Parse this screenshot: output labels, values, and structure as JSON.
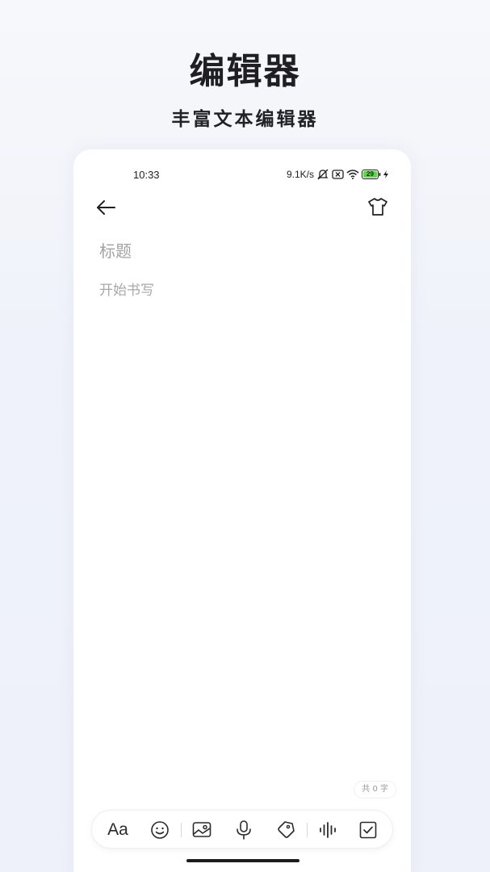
{
  "promo": {
    "title": "编辑器",
    "subtitle": "丰富文本编辑器"
  },
  "status_bar": {
    "time": "10:33",
    "net_speed": "9.1K/s",
    "battery": "29",
    "icons": [
      "mute-icon",
      "sim-x-icon",
      "wifi-icon",
      "battery-icon",
      "charging-icon"
    ]
  },
  "editor": {
    "title_placeholder": "标题",
    "body_placeholder": "开始书写",
    "word_count": "共 0 字"
  },
  "toolbar": {
    "font_label": "Aa",
    "tools": [
      "font-icon",
      "emoji-icon",
      "image-icon",
      "microphone-icon",
      "tag-icon",
      "audio-wave-icon",
      "checkbox-icon"
    ]
  }
}
